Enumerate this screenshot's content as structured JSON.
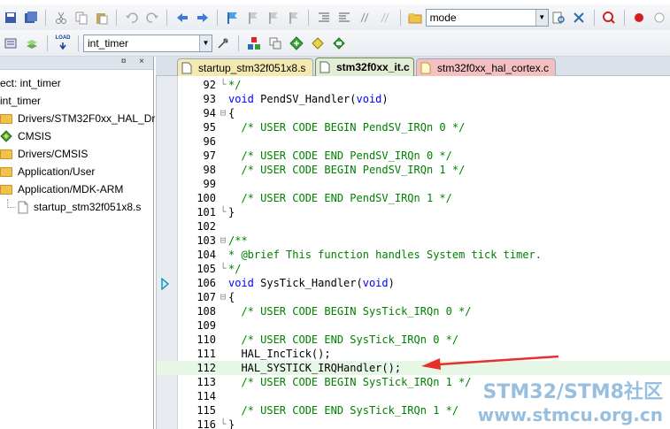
{
  "toolbar1": {
    "mode_combo_value": "mode",
    "icons": [
      "save-icon",
      "save-all-icon",
      "cut-icon",
      "copy-icon",
      "paste-icon",
      "undo-icon",
      "redo-icon",
      "nav-back-icon",
      "nav-forward-icon",
      "bookmark-icon",
      "bookmark-prev-icon",
      "bookmark-next-icon",
      "bookmark-clear-icon",
      "indent-icon",
      "unindent-icon",
      "comment-icon",
      "uncomment-icon",
      "open-folder-icon",
      "find-in-files-icon",
      "incremental-find-icon",
      "debug-session-icon",
      "breakpoint-icon",
      "disabled-breakpoint-icon"
    ]
  },
  "toolbar2": {
    "target_combo_value": "int_timer",
    "load_label": "LOAD",
    "icons": [
      "batch-build-icon",
      "rebuild-icon",
      "load-icon",
      "target-options-icon",
      "manage-components-icon",
      "components-icon",
      "select-pack-icon",
      "pack-installer-icon"
    ]
  },
  "project": {
    "header_buttons": "¤ ×",
    "root_label": "ect: int_timer",
    "target_label": "int_timer",
    "items": [
      {
        "label": "Drivers/STM32F0xx_HAL_Driv",
        "icon": "folder-icon"
      },
      {
        "label": "CMSIS",
        "icon": "component-diamond-icon"
      },
      {
        "label": "Drivers/CMSIS",
        "icon": "folder-icon"
      },
      {
        "label": "Application/User",
        "icon": "folder-icon"
      },
      {
        "label": "Application/MDK-ARM",
        "icon": "folder-icon"
      },
      {
        "label": "startup_stm32f051x8.s",
        "icon": "file-icon"
      }
    ]
  },
  "tabs": [
    {
      "label": "startup_stm32f051x8.s",
      "active": false,
      "color": "#f4e9b0"
    },
    {
      "label": "stm32f0xx_it.c",
      "active": true,
      "color": "#e3ecd4"
    },
    {
      "label": "stm32f0xx_hal_cortex.c",
      "active": false,
      "color": "#f3bfc0"
    }
  ],
  "editor": {
    "lines": [
      {
        "num": "92",
        "fold": "└",
        "code": "*/",
        "style": "cm"
      },
      {
        "num": "93",
        "fold": "",
        "code": "void PendSV_Handler(void)",
        "style": "fn"
      },
      {
        "num": "94",
        "fold": "⊟",
        "code": "{",
        "style": "plain"
      },
      {
        "num": "95",
        "fold": "",
        "code": "  /* USER CODE BEGIN PendSV_IRQn 0 */",
        "style": "cm"
      },
      {
        "num": "96",
        "fold": "",
        "code": "",
        "style": "plain"
      },
      {
        "num": "97",
        "fold": "",
        "code": "  /* USER CODE END PendSV_IRQn 0 */",
        "style": "cm"
      },
      {
        "num": "98",
        "fold": "",
        "code": "  /* USER CODE BEGIN PendSV_IRQn 1 */",
        "style": "cm"
      },
      {
        "num": "99",
        "fold": "",
        "code": "",
        "style": "plain"
      },
      {
        "num": "100",
        "fold": "",
        "code": "  /* USER CODE END PendSV_IRQn 1 */",
        "style": "cm"
      },
      {
        "num": "101",
        "fold": "└",
        "code": "}",
        "style": "plain"
      },
      {
        "num": "102",
        "fold": "",
        "code": "",
        "style": "plain"
      },
      {
        "num": "103",
        "fold": "⊟",
        "code": "/**",
        "style": "cm"
      },
      {
        "num": "104",
        "fold": "",
        "code": "* @brief This function handles System tick timer.",
        "style": "cm"
      },
      {
        "num": "105",
        "fold": "└",
        "code": "*/",
        "style": "cm"
      },
      {
        "num": "106",
        "fold": "",
        "code": "void SysTick_Handler(void)",
        "style": "fn"
      },
      {
        "num": "107",
        "fold": "⊟",
        "code": "{",
        "style": "plain"
      },
      {
        "num": "108",
        "fold": "",
        "code": "  /* USER CODE BEGIN SysTick_IRQn 0 */",
        "style": "cm"
      },
      {
        "num": "109",
        "fold": "",
        "code": "",
        "style": "plain"
      },
      {
        "num": "110",
        "fold": "",
        "code": "  /* USER CODE END SysTick_IRQn 0 */",
        "style": "cm"
      },
      {
        "num": "111",
        "fold": "",
        "code": "  HAL_IncTick();",
        "style": "plain"
      },
      {
        "num": "112",
        "fold": "",
        "code": "  HAL_SYSTICK_IRQHandler();",
        "style": "plain",
        "highlight": true
      },
      {
        "num": "113",
        "fold": "",
        "code": "  /* USER CODE BEGIN SysTick_IRQn 1 */",
        "style": "cm"
      },
      {
        "num": "114",
        "fold": "",
        "code": "",
        "style": "plain"
      },
      {
        "num": "115",
        "fold": "",
        "code": "  /* USER CODE END SysTick_IRQn 1 */",
        "style": "cm"
      },
      {
        "num": "116",
        "fold": "└",
        "code": "}",
        "style": "plain"
      }
    ],
    "current_line_marker": "106",
    "arrow_annotation_color": "#e8302a"
  },
  "watermark": {
    "title": "STM32/STM8社区",
    "url": "www.stmcu.org.cn"
  }
}
